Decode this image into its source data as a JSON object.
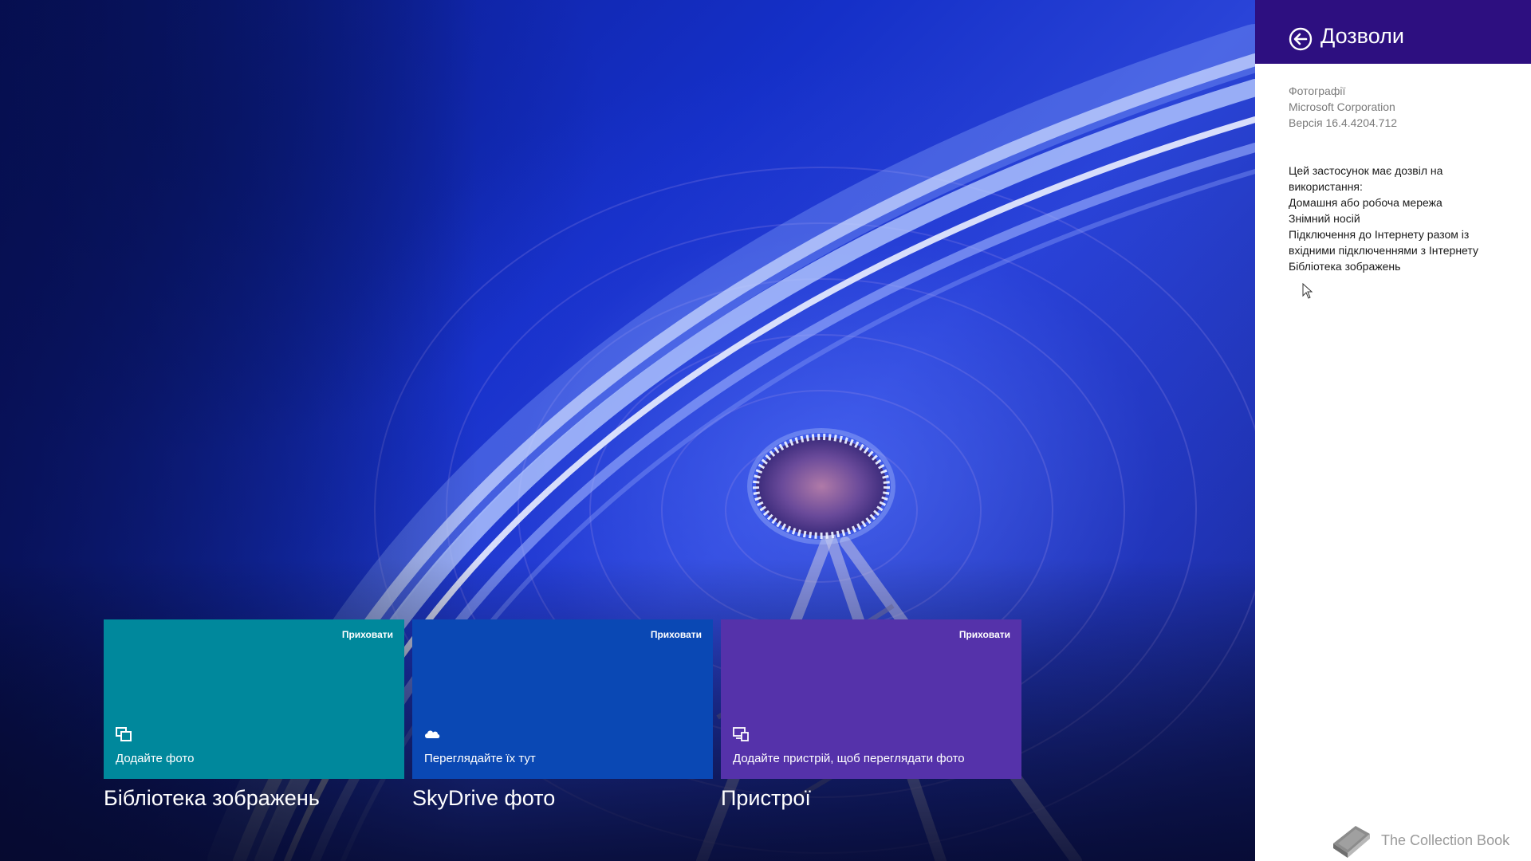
{
  "tiles": [
    {
      "hide_label": "Приховати",
      "caption": "Додайте фото",
      "title": "Бібліотека зображень",
      "icon": "picture-library-icon",
      "color": "#00889c"
    },
    {
      "hide_label": "Приховати",
      "caption": "Переглядайте їх тут",
      "title": "SkyDrive фото",
      "icon": "cloud-icon",
      "color": "#0a48b4"
    },
    {
      "hide_label": "Приховати",
      "caption": "Додайте пристрій, щоб переглядати фото",
      "title": "Пристрої",
      "icon": "devices-icon",
      "color": "#5532aa"
    }
  ],
  "pane": {
    "title": "Дозволи",
    "header_color": "#2d0f80",
    "back_icon": "back-arrow-icon",
    "app_name": "Фотографії",
    "publisher": "Microsoft Corporation",
    "version": "Версія 16.4.4204.712",
    "permissions_heading_1": "Цей застосунок має дозвіл на",
    "permissions_heading_2": "використання:",
    "permissions": [
      "Домашня або робоча мережа",
      "Знімний носій",
      "Підключення до Інтернету разом із",
      "вхідними підключеннями з Інтернету",
      "Бібліотека зображень"
    ]
  },
  "watermark": {
    "text": "The Collection Book",
    "icon": "book-icon"
  }
}
